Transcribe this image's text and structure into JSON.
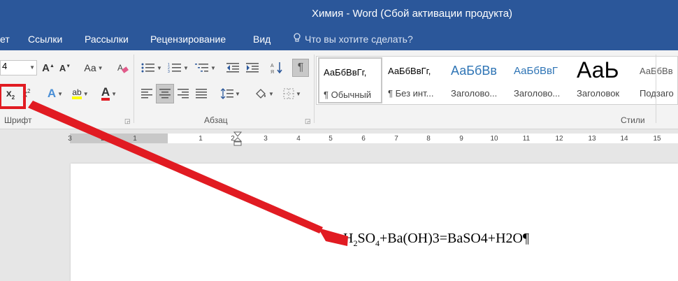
{
  "titlebar": {
    "title": "Химия - Word (Сбой активации продукта)"
  },
  "menubar": {
    "tabs": [
      "ет",
      "Ссылки",
      "Рассылки",
      "Рецензирование",
      "Вид"
    ],
    "tell_me": "Что вы хотите сделать?"
  },
  "ribbon": {
    "font_size_value": "4",
    "groups": {
      "font": "Шрифт",
      "paragraph": "Абзац",
      "styles": "Стили"
    },
    "case_button": "Аа",
    "styles": [
      {
        "sample": "АаБбВвГг,",
        "name": "¶ Обычный"
      },
      {
        "sample": "АаБбВвГг,",
        "name": "¶ Без инт..."
      },
      {
        "sample": "АаБбВв",
        "name": "Заголово..."
      },
      {
        "sample": "АаБбВвГ",
        "name": "Заголово..."
      },
      {
        "sample": "АаЬ",
        "name": "Заголовок"
      },
      {
        "sample": "АаБбВв",
        "name": "Подзаго"
      }
    ]
  },
  "ruler": {
    "ticks": [
      "3",
      "2",
      "1",
      "1",
      "2",
      "3",
      "4",
      "5",
      "6",
      "7",
      "8",
      "9",
      "10",
      "11",
      "12",
      "13",
      "14",
      "15"
    ]
  },
  "document": {
    "text_prefix": "Н",
    "text_sub": "2",
    "text_mid": "SO",
    "text_sub2": "4",
    "text_rest": "+Ba(OH)3=BaSO4+H2O¶"
  },
  "colors": {
    "title_bar": "#2b579a",
    "highlight": "#e11b22",
    "font_color_underline": "#e11b22",
    "highlight_underline": "#ffff00"
  }
}
